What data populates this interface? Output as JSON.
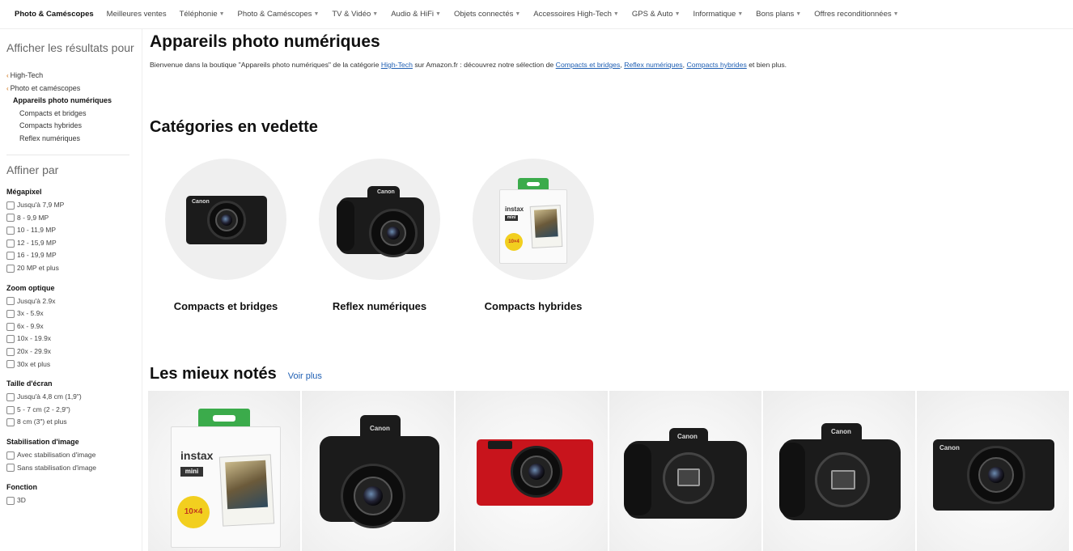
{
  "nav": {
    "active": "Photo & Caméscopes",
    "items": [
      {
        "label": "Meilleures ventes",
        "caret": false
      },
      {
        "label": "Téléphonie",
        "caret": true
      },
      {
        "label": "Photo & Caméscopes",
        "caret": true
      },
      {
        "label": "TV & Vidéo",
        "caret": true
      },
      {
        "label": "Audio & HiFi",
        "caret": true
      },
      {
        "label": "Objets connectés",
        "caret": true
      },
      {
        "label": "Accessoires High-Tech",
        "caret": true
      },
      {
        "label": "GPS & Auto",
        "caret": true
      },
      {
        "label": "Informatique",
        "caret": true
      },
      {
        "label": "Bons plans",
        "caret": true
      },
      {
        "label": "Offres reconditionnées",
        "caret": true
      }
    ]
  },
  "sidebar": {
    "show_results_heading": "Afficher les résultats pour",
    "crumbs": [
      "High-Tech",
      "Photo et caméscopes"
    ],
    "current": "Appareils photo numériques",
    "subcategories": [
      "Compacts et bridges",
      "Compacts hybrides",
      "Reflex numériques"
    ],
    "refine_heading": "Affiner par",
    "facets": [
      {
        "title": "Mégapixel",
        "options": [
          "Jusqu'à 7,9 MP",
          "8 - 9,9 MP",
          "10 - 11,9 MP",
          "12 - 15,9 MP",
          "16 - 19,9 MP",
          "20 MP et plus"
        ]
      },
      {
        "title": "Zoom optique",
        "options": [
          "Jusqu'à 2.9x",
          "3x - 5.9x",
          "6x - 9.9x",
          "10x - 19.9x",
          "20x - 29.9x",
          "30x et plus"
        ]
      },
      {
        "title": "Taille d'écran",
        "options": [
          "Jusqu'à 4,8 cm (1,9\")",
          "5 - 7 cm (2 - 2,9\")",
          "8 cm (3\") et plus"
        ]
      },
      {
        "title": "Stabilisation d'image",
        "options": [
          "Avec stabilisation d'image",
          "Sans stabilisation d'image"
        ]
      },
      {
        "title": "Fonction",
        "options": [
          "3D"
        ]
      }
    ]
  },
  "main": {
    "title": "Appareils photo numériques",
    "intro": {
      "p1": "Bienvenue dans la boutique \"Appareils photo numériques\" de la catégorie ",
      "link1": "High-Tech",
      "p2": " sur Amazon.fr : découvrez notre sélection de ",
      "link2": "Compacts et bridges",
      "p3": ", ",
      "link3": "Reflex numériques",
      "p4": ", ",
      "link4": "Compacts hybrides",
      "p5": " et bien plus."
    },
    "featured_heading": "Catégories en vedette",
    "featured": [
      {
        "label": "Compacts et bridges"
      },
      {
        "label": "Reflex numériques"
      },
      {
        "label": "Compacts hybrides"
      }
    ],
    "top_rated_heading": "Les mieux notés",
    "see_more": "Voir plus",
    "brand_canon": "Canon",
    "instax_logo": "instax",
    "instax_mini": "mini",
    "instax_badge": "10×4",
    "colors": {
      "link": "#1f5fb3",
      "instax_green": "#3bab4b",
      "camera_red": "#c8141c"
    }
  }
}
